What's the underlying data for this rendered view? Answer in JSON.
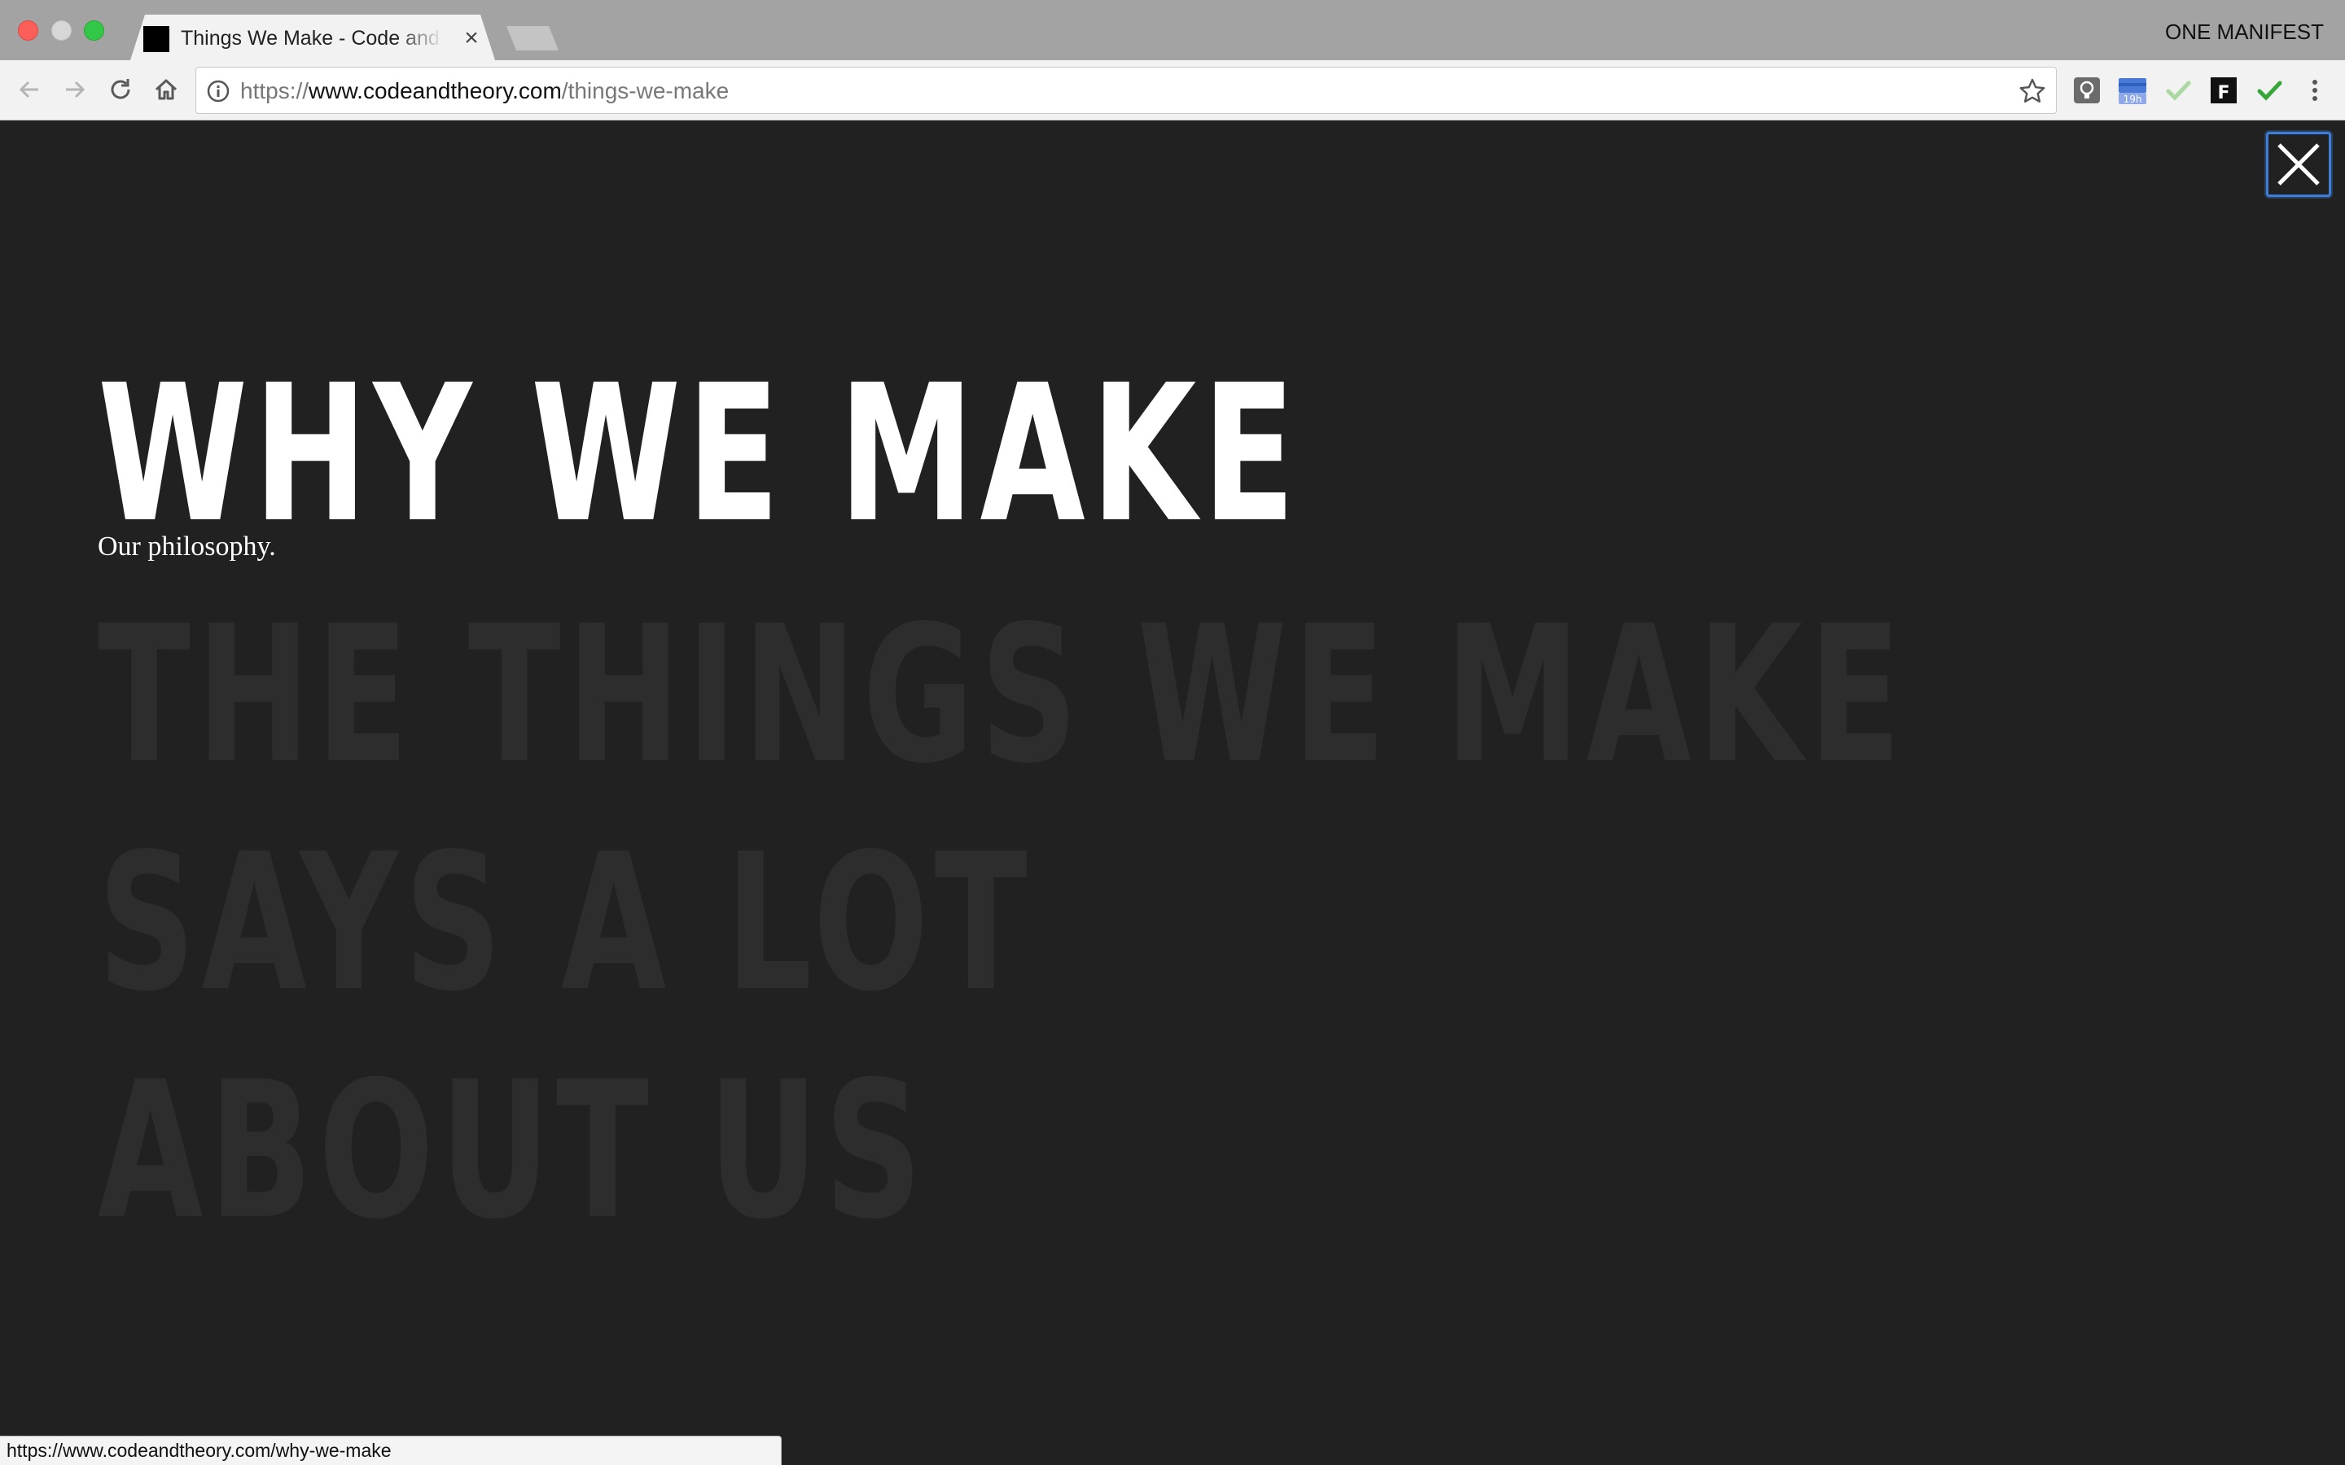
{
  "browser": {
    "tab": {
      "title": "Things We Make - Code and Theory",
      "close_glyph": "×"
    },
    "profile_name": "ONE MANIFEST",
    "address": {
      "scheme": "https://",
      "host": "www.codeandtheory.com",
      "path": "/things-we-make"
    },
    "extensions": [
      {
        "icon": "lightbulb-extension-icon"
      },
      {
        "icon": "calendar-extension-icon",
        "badge": "19h"
      },
      {
        "icon": "checkmark-light-extension-icon"
      },
      {
        "icon": "fb-extension-icon"
      },
      {
        "icon": "checkmark-green-extension-icon"
      }
    ],
    "status_url": "https://www.codeandtheory.com/why-we-make"
  },
  "page": {
    "heading": "WHY WE MAKE",
    "subheading": "Our philosophy.",
    "tagline": [
      "THE THINGS WE MAKE",
      "SAYS A LOT",
      "ABOUT US"
    ]
  },
  "colors": {
    "page_background": "#212121",
    "heading": "#ffffff",
    "tagline": "#2d2d2d",
    "focus_ring": "#3d7fd8"
  }
}
